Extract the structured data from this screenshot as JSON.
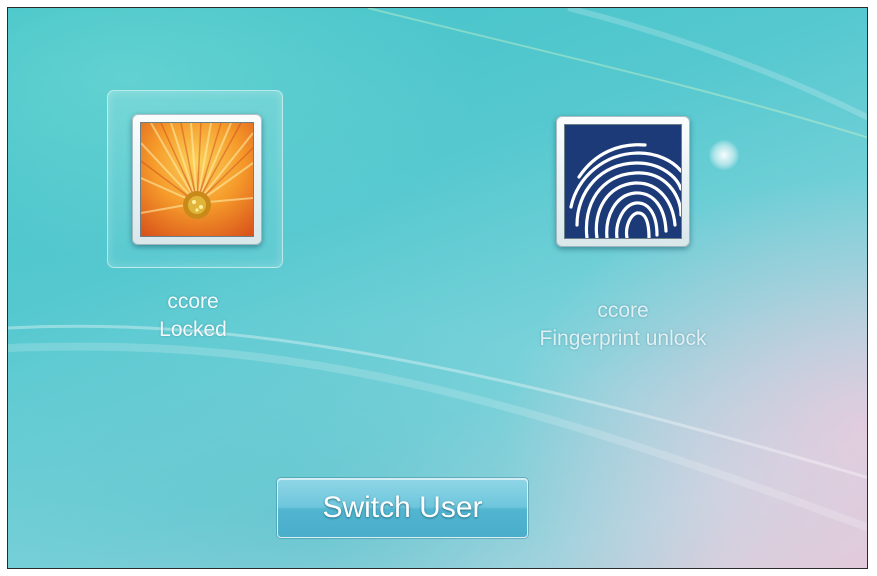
{
  "users": [
    {
      "name": "ccore",
      "status": "Locked",
      "avatar_icon": "flower-avatar-icon",
      "selected": true
    },
    {
      "name": "ccore",
      "status": "Fingerprint unlock",
      "avatar_icon": "fingerprint-icon",
      "selected": false
    }
  ],
  "actions": {
    "switch_user_label": "Switch User"
  },
  "colors": {
    "background_primary": "#4fc6cc",
    "fingerprint_tile": "#1c3a78",
    "flower_orange": "#f07a1e"
  }
}
